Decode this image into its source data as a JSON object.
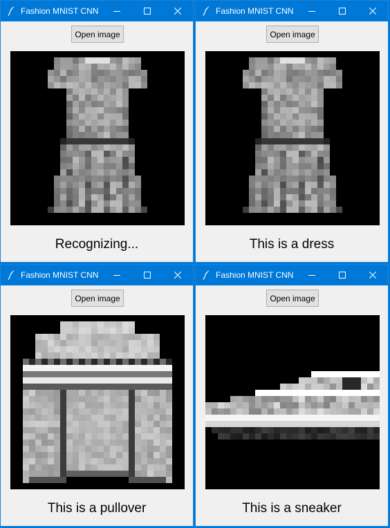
{
  "app": {
    "title": "Fashion MNIST CNN",
    "open_button_label": "Open image",
    "icons": [
      "feather-icon",
      "minimize-icon",
      "maximize-icon",
      "close-icon"
    ]
  },
  "windows": [
    {
      "status": "Recognizing...",
      "image": "dress"
    },
    {
      "status": "This is a dress",
      "image": "dress"
    },
    {
      "status": "This is a pullover",
      "image": "pullover"
    },
    {
      "status": "This is a sneaker",
      "image": "sneaker"
    }
  ]
}
